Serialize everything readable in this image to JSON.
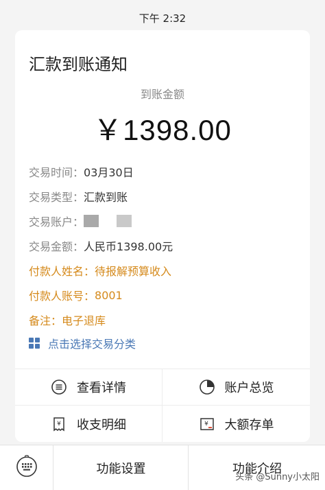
{
  "status_bar": {
    "time": "下午 2:32"
  },
  "card": {
    "title": "汇款到账通知",
    "amount_label": "到账金额",
    "amount": "￥1398.00"
  },
  "details": [
    {
      "label": "交易时间：",
      "value": "03月30日"
    },
    {
      "label": "交易类型：",
      "value": "汇款到账"
    },
    {
      "label": "交易账户：",
      "value": ""
    },
    {
      "label": "交易金额：",
      "value": "人民币1398.00元"
    },
    {
      "label": "付款人姓名：",
      "value": "待报解预算收入"
    },
    {
      "label": "付款人账号：",
      "value": "8001"
    },
    {
      "label": "备注：",
      "value": "电子退库"
    }
  ],
  "classify_link": "点击选择交易分类",
  "actions": {
    "view_details": "查看详情",
    "account_overview": "账户总览",
    "income_expense": "收支明细",
    "large_deposit": "大额存单"
  },
  "bottom_bar": {
    "settings": "功能设置",
    "intro": "功能介绍"
  },
  "watermark": "头条 @Sunny小太阳",
  "colors": {
    "highlight": "#d58a1c",
    "link": "#4a78b5",
    "icon_red": "#e0533d"
  }
}
